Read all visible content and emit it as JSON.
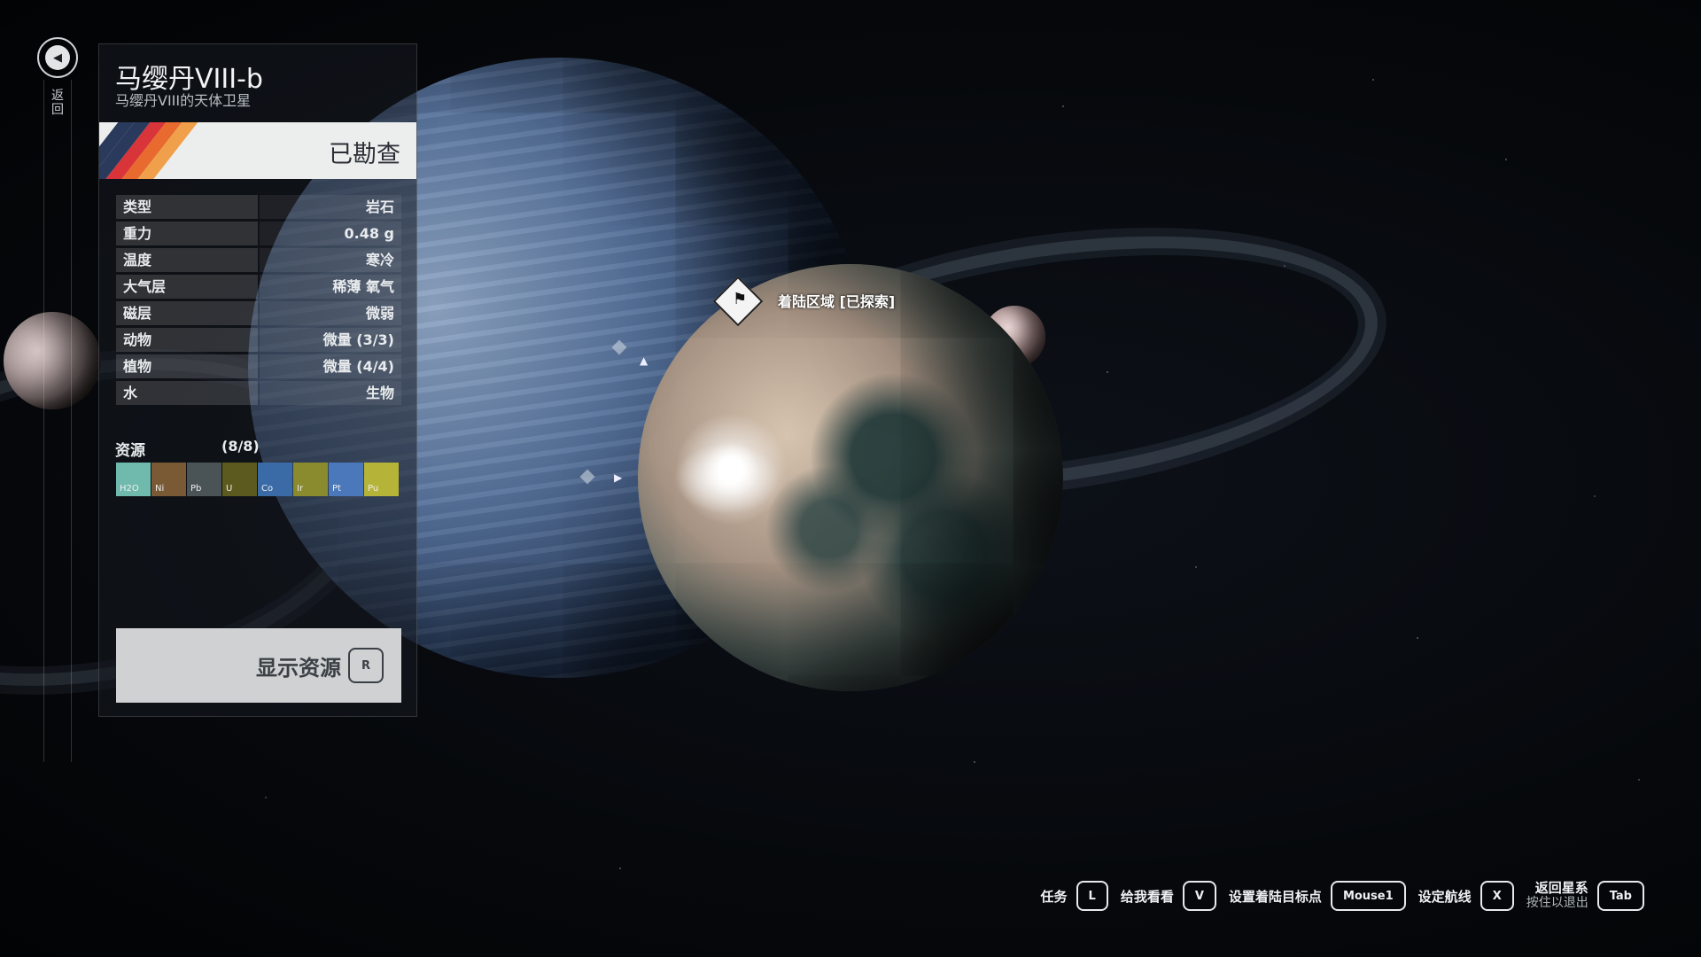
{
  "planet": {
    "name": "马缨丹VIII-b",
    "subtitle": "马缨丹VIII的天体卫星",
    "status": "已勘查"
  },
  "nav": {
    "rail_label": "返回"
  },
  "stats": [
    {
      "key": "类型",
      "value": "岩石"
    },
    {
      "key": "重力",
      "value": "0.48 g"
    },
    {
      "key": "温度",
      "value": "寒冷"
    },
    {
      "key": "大气层",
      "value": "稀薄 氧气"
    },
    {
      "key": "磁层",
      "value": "微弱"
    },
    {
      "key": "动物",
      "value": "微量 (3/3)"
    },
    {
      "key": "植物",
      "value": "微量 (4/4)"
    },
    {
      "key": "水",
      "value": "生物"
    }
  ],
  "resources": {
    "label": "资源",
    "count": "(8/8)",
    "items": [
      {
        "symbol": "H2O",
        "color": "#6fb9ad"
      },
      {
        "symbol": "Ni",
        "color": "#7a5a34"
      },
      {
        "symbol": "Pb",
        "color": "#4a5457"
      },
      {
        "symbol": "U",
        "color": "#5d5a1f"
      },
      {
        "symbol": "Co",
        "color": "#3b6ba6"
      },
      {
        "symbol": "Ir",
        "color": "#8a8a2e"
      },
      {
        "symbol": "Pt",
        "color": "#4a78bb"
      },
      {
        "symbol": "Pu",
        "color": "#b5b338"
      }
    ]
  },
  "show_resources": {
    "label": "显示资源",
    "key": "R"
  },
  "marker": {
    "label": "着陆区域 [已探索]"
  },
  "hints": [
    {
      "label": "任务",
      "key": "L"
    },
    {
      "label": "给我看看",
      "key": "V"
    },
    {
      "label": "设置着陆目标点",
      "key": "Mouse1"
    },
    {
      "label": "设定航线",
      "key": "X"
    },
    {
      "label": "返回星系",
      "sublabel": "按住以退出",
      "key": "Tab"
    }
  ],
  "colors": {
    "stripe_red": "#d8343a",
    "stripe_orange": "#e86a2e",
    "stripe_amber": "#f0a04a",
    "panel_bg": "#161a20"
  }
}
